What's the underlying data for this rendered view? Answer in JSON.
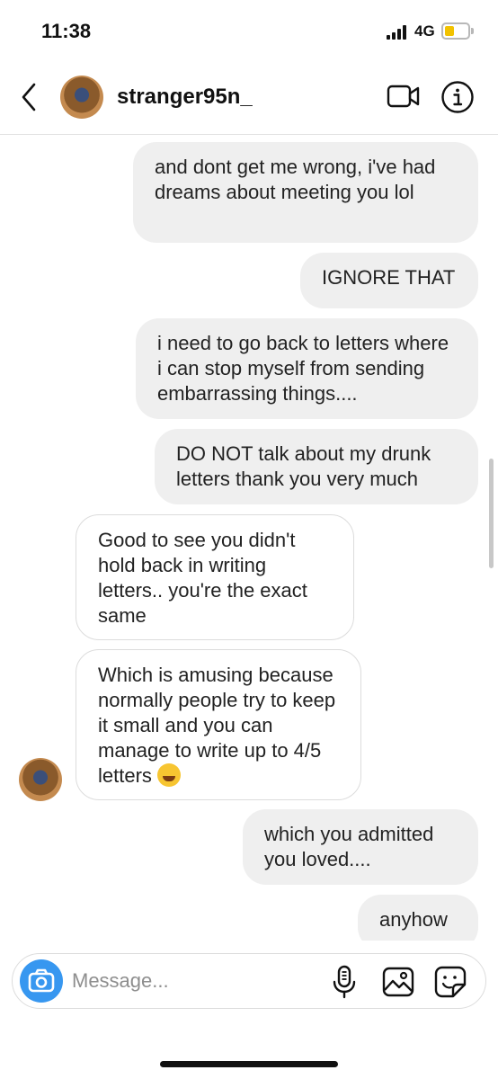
{
  "status_bar": {
    "time": "11:38",
    "network": "4G",
    "battery_level": 0.4,
    "battery_color": "#f2c200"
  },
  "header": {
    "username": "stranger95n_",
    "back_icon": "chevron-left-icon",
    "video_icon": "video-camera-icon",
    "info_icon": "info-icon"
  },
  "messages": [
    {
      "direction": "outgoing",
      "text": "and dont get me wrong, i've had dreams about meeting you lol"
    },
    {
      "direction": "outgoing",
      "text": "IGNORE THAT"
    },
    {
      "direction": "outgoing",
      "text": "i need to go back to letters where i can stop myself from sending embarrassing things...."
    },
    {
      "direction": "outgoing",
      "text": "DO NOT talk about my drunk letters thank you very much"
    },
    {
      "direction": "incoming",
      "text": "Good to see you didn't hold back in writing letters.. you're the exact same"
    },
    {
      "direction": "incoming",
      "text": "Which is amusing because normally people try to keep it small and you can manage to write up to 4/5 letters",
      "emoji": "rolling-on-floor-laughing"
    },
    {
      "direction": "outgoing",
      "text": "which you admitted you loved...."
    },
    {
      "direction": "outgoing",
      "text": "anyhow"
    }
  ],
  "composer": {
    "placeholder": "Message...",
    "camera_icon": "camera-icon",
    "mic_icon": "microphone-icon",
    "gallery_icon": "image-icon",
    "sticker_icon": "sticker-icon"
  },
  "colors": {
    "accent": "#3797f0",
    "outgoing_bubble": "#efefef",
    "incoming_border": "#dcdcdc"
  }
}
